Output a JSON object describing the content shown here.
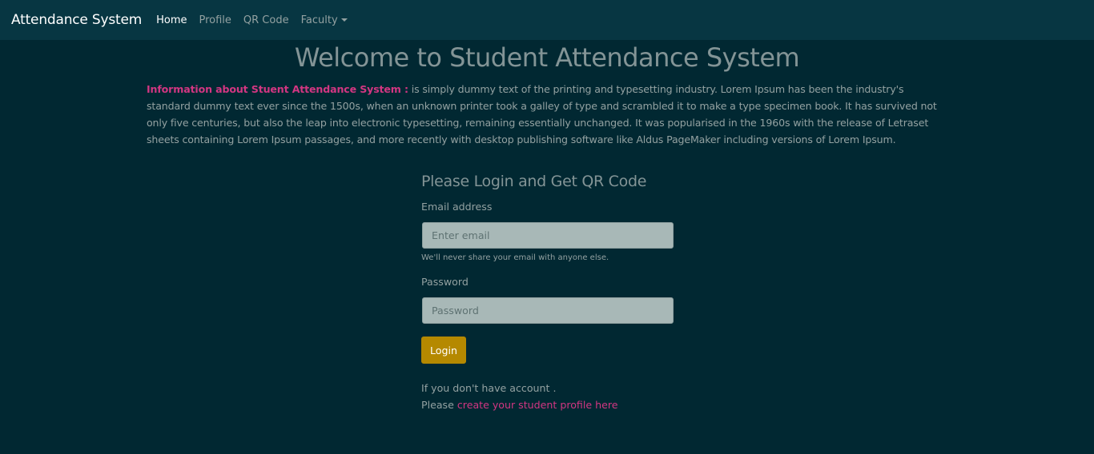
{
  "navbar": {
    "brand": "Attendance System",
    "links": [
      "Home",
      "Profile",
      "QR Code",
      "Faculty"
    ],
    "active": "Home"
  },
  "page_title": "Welcome to Student Attendance System",
  "info": {
    "title": "Information about Stuent Attendance System :",
    "body": " is simply dummy text of the printing and typesetting industry. Lorem Ipsum has been the industry's standard dummy text ever since the 1500s, when an unknown printer took a galley of type and scrambled it to make a type specimen book. It has survived not only five centuries, but also the leap into electronic typesetting, remaining essentially unchanged. It was popularised in the 1960s with the release of Letraset sheets containing Lorem Ipsum passages, and more recently with desktop publishing software like Aldus PageMaker including versions of Lorem Ipsum."
  },
  "login": {
    "heading": "Please Login and Get QR Code",
    "email_label": "Email address",
    "email_placeholder": "Enter email",
    "email_help": "We'll never share your email with anyone else.",
    "password_label": "Password",
    "password_placeholder": "Password",
    "submit_label": "Login"
  },
  "signup": {
    "line1": "If you don't have account .",
    "prefix": "Please ",
    "link_text": "create your student profile here"
  },
  "colors": {
    "background": "#012832",
    "navbar": "#073642",
    "accent_pink": "#d33682",
    "button_gold": "#b58900",
    "input_bg": "#a8b8b7"
  }
}
